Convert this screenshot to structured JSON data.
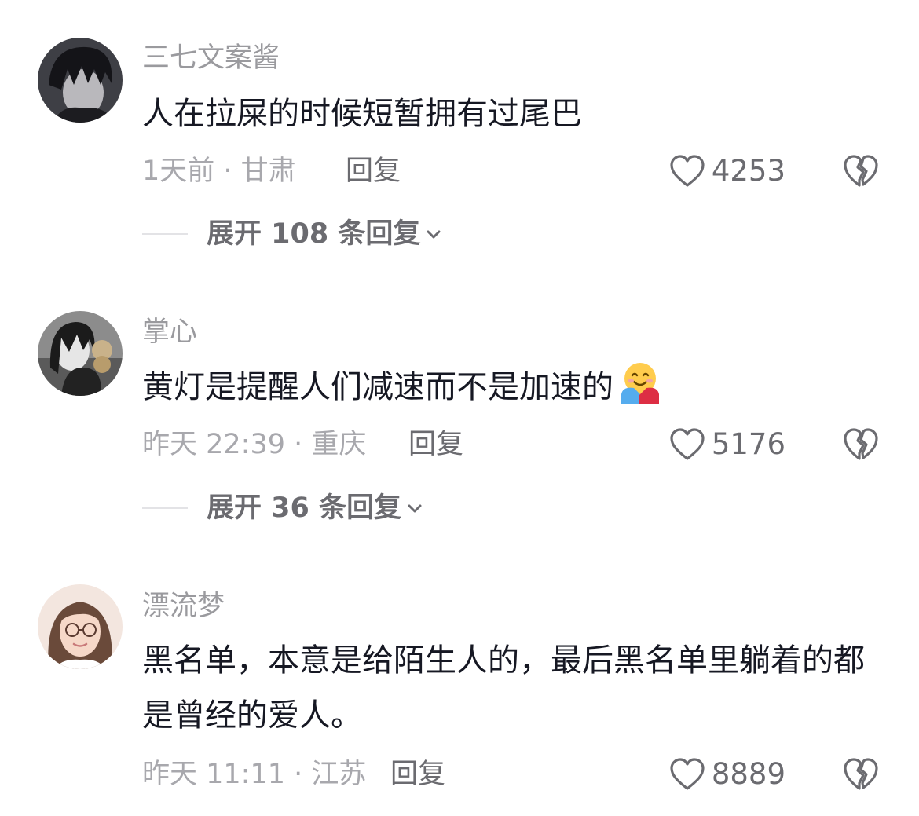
{
  "comments": [
    {
      "username": "三七文案酱",
      "text": "人在拉屎的时候短暂拥有过尾巴",
      "meta": "1天前 · 甘肃",
      "reply_label": "回复",
      "likes": "4253",
      "expand_label": "展开 108 条回复",
      "avatar_colors": {
        "bg": "#3e3f45",
        "hair": "#141418",
        "skin": "#b9b8bc"
      }
    },
    {
      "username": "掌心",
      "text": "黄灯是提醒人们减速而不是加速的",
      "emoji": "hugging-face-emoji",
      "meta": "昨天 22:39 · 重庆",
      "reply_label": "回复",
      "likes": "5176",
      "expand_label": "展开 36 条回复",
      "avatar_colors": {
        "bg": "#8c8c8c",
        "hair": "#1b1b1b",
        "skin": "#e6e6e6"
      }
    },
    {
      "username": "漂流梦",
      "text": "黑名单，本意是给陌生人的，最后黑名单里躺着的都是曾经的爱人。",
      "meta": "昨天 11:11 · 江苏",
      "reply_label": "回复",
      "likes": "8889",
      "avatar_colors": {
        "bg": "#f3e6df",
        "hair": "#6a4a3a",
        "skin": "#f6d8c8"
      }
    }
  ],
  "icons": {
    "like": "heart-outline-icon",
    "dislike": "broken-heart-icon",
    "expand": "chevron-down-icon"
  },
  "colors": {
    "primary_text": "#161823",
    "secondary_text": "#9a9a9e",
    "action_text": "#6b6b70"
  }
}
